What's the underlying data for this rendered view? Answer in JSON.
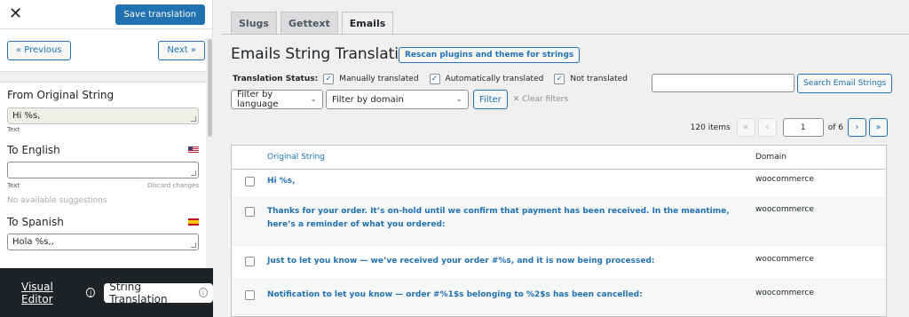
{
  "sidebar": {
    "close": "✕",
    "save_label": "Save translation",
    "prev_label": "« Previous",
    "next_label": "Next »",
    "from_heading": "From Original String",
    "from_value": "Hi %s,",
    "from_type": "Text",
    "english_heading": "To English",
    "english_value": "",
    "english_type": "Text",
    "discard_label": "Discard changes",
    "no_suggestions": "No available suggestions",
    "spanish_heading": "To Spanish",
    "spanish_value": "Hola %s,,"
  },
  "footer": {
    "visual_editor": "Visual Editor",
    "string_translation": "String Translation"
  },
  "tabs": [
    "Slugs",
    "Gettext",
    "Emails"
  ],
  "main": {
    "title": "Emails String Translation",
    "rescan_label": "Rescan plugins and theme for strings",
    "status_label": "Translation Status:",
    "status_options": [
      "Manually translated",
      "Automatically translated",
      "Not translated"
    ],
    "filter_language": "Filter by language",
    "filter_domain": "Filter by domain",
    "filter_button": "Filter",
    "clear_filters": "Clear filters",
    "search_button": "Search Email Strings",
    "items_count": "120 items",
    "page_current": "1",
    "page_of": "of 6"
  },
  "table": {
    "headers": [
      "Original String",
      "Domain"
    ],
    "rows": [
      {
        "original": "Hi %s,",
        "domain": "woocommerce"
      },
      {
        "original": "Thanks for your order. It’s on-hold until we confirm that payment has been received. In the meantime, here’s a reminder of what you ordered:",
        "domain": "woocommerce"
      },
      {
        "original": "Just to let you know — we’ve received your order #%s, and it is now being processed:",
        "domain": "woocommerce"
      },
      {
        "original": "Notification to let you know — order #%1$s belonging to %2$s has been cancelled:",
        "domain": "woocommerce"
      }
    ]
  },
  "colors": {
    "accent": "#2271b1",
    "footer_bg": "#1d2327"
  }
}
